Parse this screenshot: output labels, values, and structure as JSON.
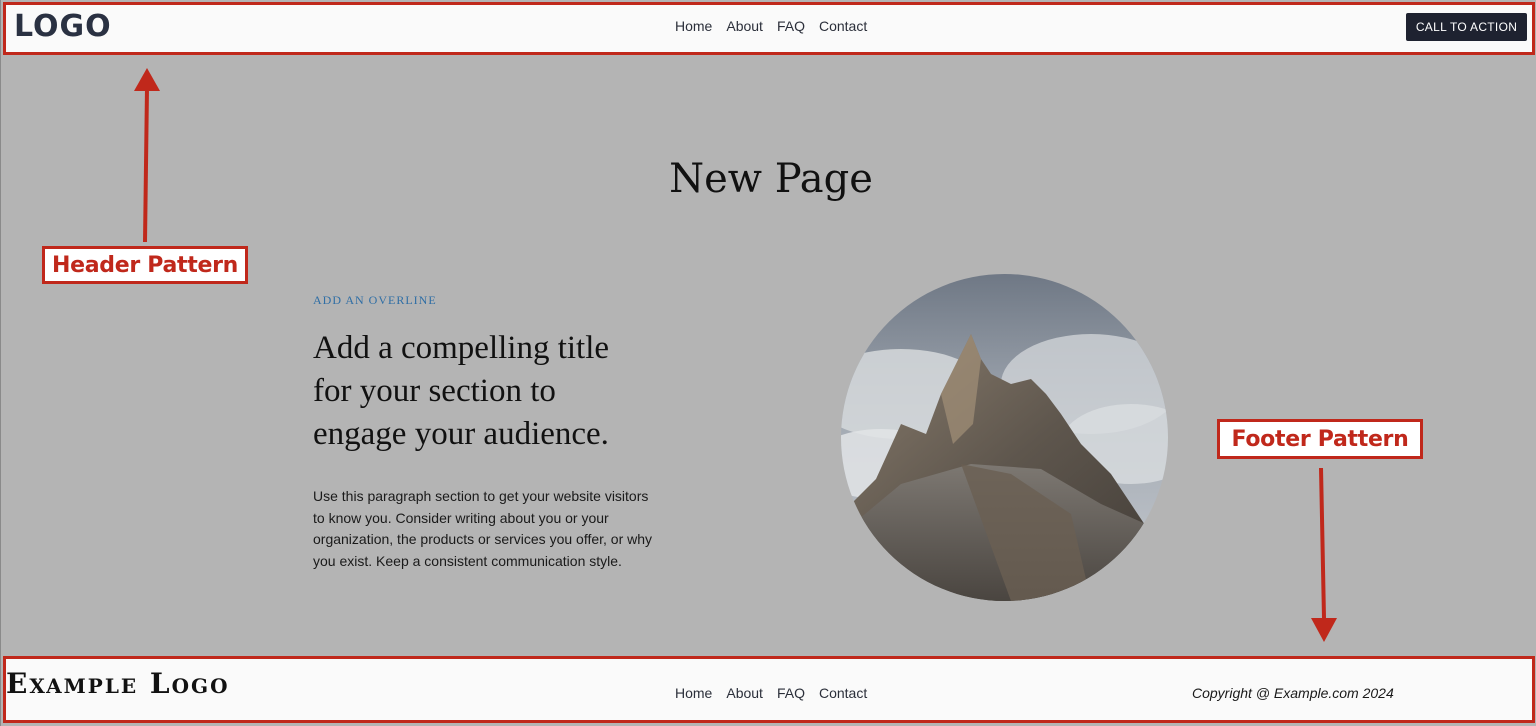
{
  "header": {
    "logo": "LOGO",
    "nav": [
      "Home",
      "About",
      "FAQ",
      "Contact"
    ],
    "cta_label": "CALL TO ACTION"
  },
  "annotations": {
    "header_label": "Header Pattern",
    "footer_label": "Footer Pattern",
    "color": "#c0281b"
  },
  "main": {
    "page_title": "New Page",
    "overline": "ADD AN OVERLINE",
    "section_title": "Add a compelling title for your section to engage your audience.",
    "paragraph": "Use this paragraph section to get your website visitors to know you. Consider writing about you or your organization, the products or services you offer, or why you exist. Keep a consistent communication style.",
    "image": "mountain-photo"
  },
  "footer": {
    "logo": "Example Logo",
    "nav": [
      "Home",
      "About",
      "FAQ",
      "Contact"
    ],
    "copyright": "Copyright @ Example.com 2024"
  },
  "colors": {
    "background": "#b4b4b4",
    "cta_bg": "#1e2230",
    "overline": "#2f6ea5"
  }
}
